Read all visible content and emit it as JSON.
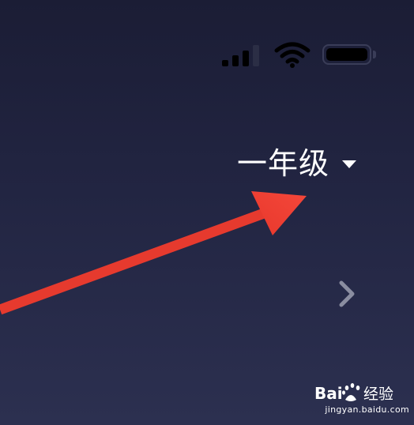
{
  "status_bar": {
    "icons": [
      "signal-icon",
      "wifi-icon",
      "battery-icon"
    ]
  },
  "grade_selector": {
    "label": "一年级",
    "icon": "dropdown-icon"
  },
  "chevron": {
    "icon": "chevron-right-icon"
  },
  "annotation": {
    "icon": "arrow-icon",
    "color": "#ef4135"
  },
  "watermark": {
    "logo_text": "Baidu经验",
    "url": "jingyan.baidu.com"
  },
  "colors": {
    "background_top": "#1b1d35",
    "background_bottom": "#2c3050",
    "text": "#ffffff",
    "annotation": "#ef4135"
  }
}
